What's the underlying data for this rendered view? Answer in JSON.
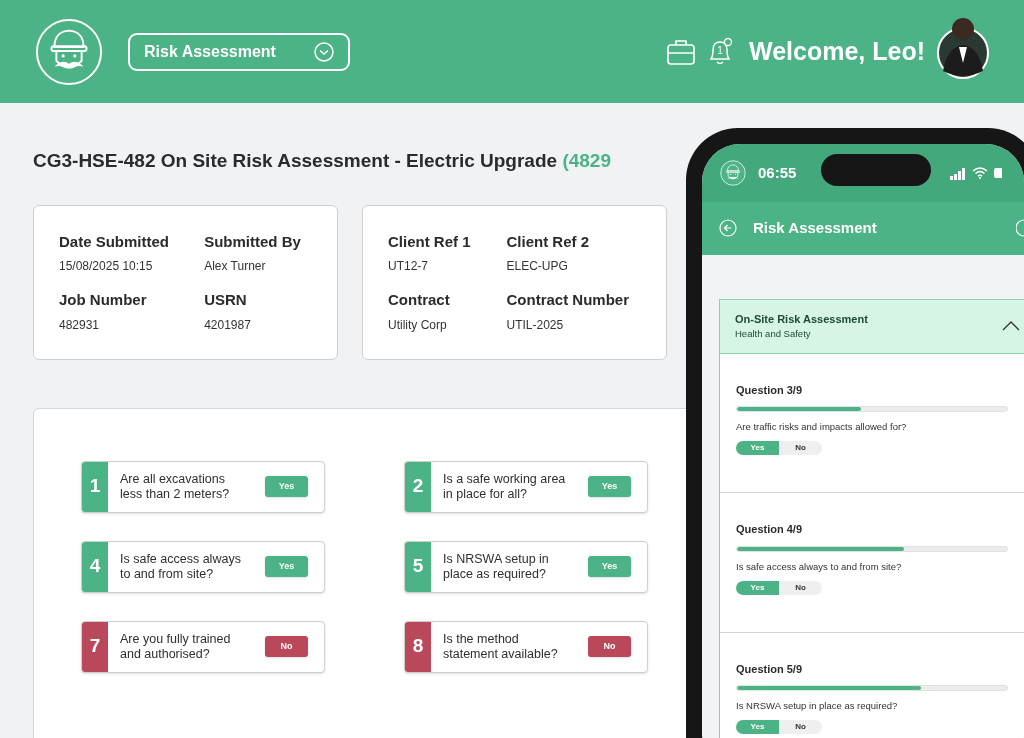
{
  "header": {
    "module": "Risk Assessment",
    "notification_count": "1",
    "welcome": "Welcome, Leo!"
  },
  "title": {
    "text": "CG3-HSE-482 On Site Risk Assessment - Electric Upgrade",
    "ref": "(4829"
  },
  "info_cards": [
    {
      "fields": [
        {
          "label": "Date Submitted",
          "value": "15/08/2025 10:15"
        },
        {
          "label": "Submitted By",
          "value": "Alex Turner"
        },
        {
          "label": "Job Number",
          "value": "482931"
        },
        {
          "label": "USRN",
          "value": "4201987"
        }
      ]
    },
    {
      "fields": [
        {
          "label": "Client Ref 1",
          "value": "UT12-7"
        },
        {
          "label": "Client Ref 2",
          "value": "ELEC-UPG"
        },
        {
          "label": "Contract",
          "value": "Utility Corp"
        },
        {
          "label": "Contract Number",
          "value": "UTIL-2025"
        }
      ]
    }
  ],
  "questions": [
    {
      "number": "1",
      "text": "Are all excavations less than 2 meters?",
      "answer": "Yes",
      "kind": "yes"
    },
    {
      "number": "2",
      "text": "Is a safe working area in place for all?",
      "answer": "Yes",
      "kind": "yes"
    },
    {
      "number": "4",
      "text": "Is safe access always to and from site?",
      "answer": "Yes",
      "kind": "yes"
    },
    {
      "number": "5",
      "text": "Is NRSWA setup in place as required?",
      "answer": "Yes",
      "kind": "yes"
    },
    {
      "number": "7",
      "text": "Are you fully trained and authorised?",
      "answer": "No",
      "kind": "no"
    },
    {
      "number": "8",
      "text": "Is the method statement available?",
      "answer": "No",
      "kind": "no"
    }
  ],
  "phone": {
    "time": "06:55",
    "title": "Risk Assessment",
    "section": {
      "title": "On-Site Risk Assessment",
      "subtitle": "Health and Safety",
      "expanded": true
    },
    "questions": [
      {
        "heading": "Question 3/9",
        "level": 0.46,
        "text": "Are traffic risks and impacts allowed for?",
        "options": [
          {
            "label": "Yes",
            "selected": true
          },
          {
            "label": "No",
            "selected": false
          }
        ]
      },
      {
        "heading": "Question 4/9",
        "level": 0.62,
        "text": "Is safe access always to and from site?",
        "options": [
          {
            "label": "Yes",
            "selected": true
          },
          {
            "label": "No",
            "selected": false
          }
        ]
      },
      {
        "heading": "Question 5/9",
        "level": 0.68,
        "text": "Is NRSWA setup in place as required?",
        "options": [
          {
            "label": "Yes",
            "selected": true
          },
          {
            "label": "No",
            "selected": false
          }
        ]
      }
    ]
  }
}
